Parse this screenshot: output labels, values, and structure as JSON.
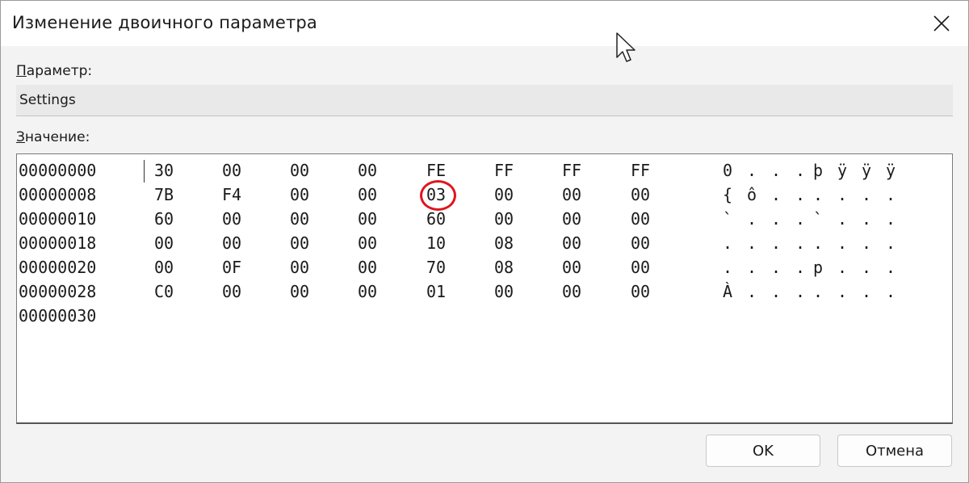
{
  "window": {
    "title": "Изменение двоичного параметра"
  },
  "param": {
    "label_prefix": "П",
    "label_rest": "араметр:",
    "value": "Settings"
  },
  "value_section": {
    "label_prefix": "З",
    "label_rest": "начение:"
  },
  "hex_rows": [
    {
      "offset": "00000000",
      "bytes": [
        "30",
        "00",
        "00",
        "00",
        "FE",
        "FF",
        "FF",
        "FF"
      ],
      "ascii": [
        "0",
        ".",
        ".",
        ".",
        "þ",
        "ÿ",
        "ÿ",
        "ÿ"
      ]
    },
    {
      "offset": "00000008",
      "bytes": [
        "7B",
        "F4",
        "00",
        "00",
        "03",
        "00",
        "00",
        "00"
      ],
      "ascii": [
        "{",
        "ô",
        ".",
        ".",
        ".",
        ".",
        ".",
        "."
      ]
    },
    {
      "offset": "00000010",
      "bytes": [
        "60",
        "00",
        "00",
        "00",
        "60",
        "00",
        "00",
        "00"
      ],
      "ascii": [
        "`",
        ".",
        ".",
        ".",
        "`",
        ".",
        ".",
        "."
      ]
    },
    {
      "offset": "00000018",
      "bytes": [
        "00",
        "00",
        "00",
        "00",
        "10",
        "08",
        "00",
        "00"
      ],
      "ascii": [
        ".",
        ".",
        ".",
        ".",
        ".",
        ".",
        ".",
        "."
      ]
    },
    {
      "offset": "00000020",
      "bytes": [
        "00",
        "0F",
        "00",
        "00",
        "70",
        "08",
        "00",
        "00"
      ],
      "ascii": [
        ".",
        ".",
        ".",
        ".",
        "p",
        ".",
        ".",
        "."
      ]
    },
    {
      "offset": "00000028",
      "bytes": [
        "C0",
        "00",
        "00",
        "00",
        "01",
        "00",
        "00",
        "00"
      ],
      "ascii": [
        "À",
        ".",
        ".",
        ".",
        ".",
        ".",
        ".",
        "."
      ]
    },
    {
      "offset": "00000030",
      "bytes": [],
      "ascii": []
    }
  ],
  "highlight": {
    "row": 1,
    "byte_index": 4,
    "color": "#e0141e"
  },
  "buttons": {
    "ok": "OK",
    "cancel": "Отмена"
  },
  "icons": {
    "close": "close-icon",
    "cursor": "mouse-pointer-icon"
  }
}
